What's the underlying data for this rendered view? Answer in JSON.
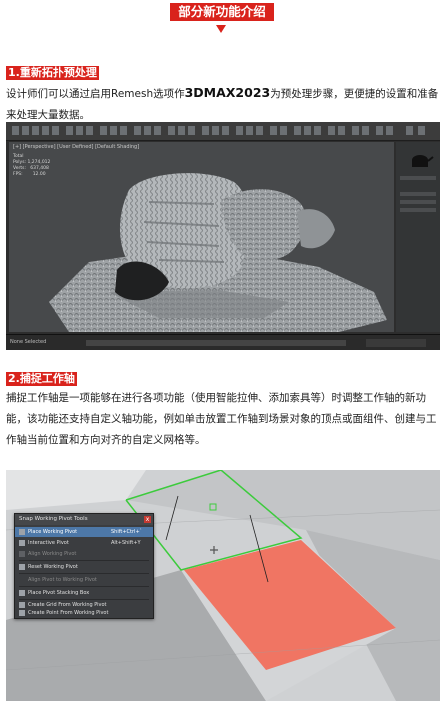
{
  "header": {
    "title": "部分新功能介绍"
  },
  "section1": {
    "tag": "1.重新拓扑预处理",
    "para_before": "设计师们可以通过启用Remesh选项作",
    "para_bold": "3DMAX2023",
    "para_after": "为预处理步骤，更便捷的设置和准备来处理大量数据。"
  },
  "max_screenshot": {
    "viewport_label": "[+] [Perspective] [User Defined] [Default Shading]",
    "stats": "Total\nPolys: 1,274,012\nVerts:   637,408\nFPS:       12.00",
    "status": "None Selected",
    "colors": {
      "background": "#2d2d2d",
      "viewport": "#47494b",
      "mesh": "#a4a8ab"
    }
  },
  "section2": {
    "tag": "2.捕捉工作轴",
    "lines": [
      "捕捉工作轴是一项能够在进行各项功能（使用智能拉伸、添加索具等）时调整工作轴的新功",
      "能，该功能还支持自定义轴功能，例如单击放置工作轴到场景对象的顶点或面组件、创建与工",
      "作轴当前位置和方向对齐的自定义网格等。"
    ]
  },
  "snap_screenshot": {
    "menu_title": "Snap Working Pivot Tools",
    "close_label": "x",
    "items": [
      {
        "label": "Place Working Pivot",
        "shortcut": "Shift+Ctrl+`",
        "state": "selected"
      },
      {
        "label": "Interactive Pivot",
        "shortcut": "Alt+Shift+Y",
        "state": "enabled"
      },
      {
        "label": "Align Working Pivot",
        "shortcut": "",
        "state": "disabled"
      },
      {
        "label": "Reset Working Pivot",
        "shortcut": "",
        "state": "enabled"
      },
      {
        "label": "Align Pivot to Working Pivot",
        "shortcut": "",
        "state": "disabled"
      },
      {
        "label": "Place Pivot Stacking Box",
        "shortcut": "",
        "state": "enabled"
      },
      {
        "label": "Create Grid From Working Pivot",
        "shortcut": "",
        "state": "enabled"
      },
      {
        "label": "Create Point From Working Pivot",
        "shortcut": "",
        "state": "enabled"
      }
    ],
    "colors": {
      "highlight_face": "#f07563",
      "pivot_outline": "#3ccb3c",
      "selected_item": "#4d78a8"
    }
  }
}
